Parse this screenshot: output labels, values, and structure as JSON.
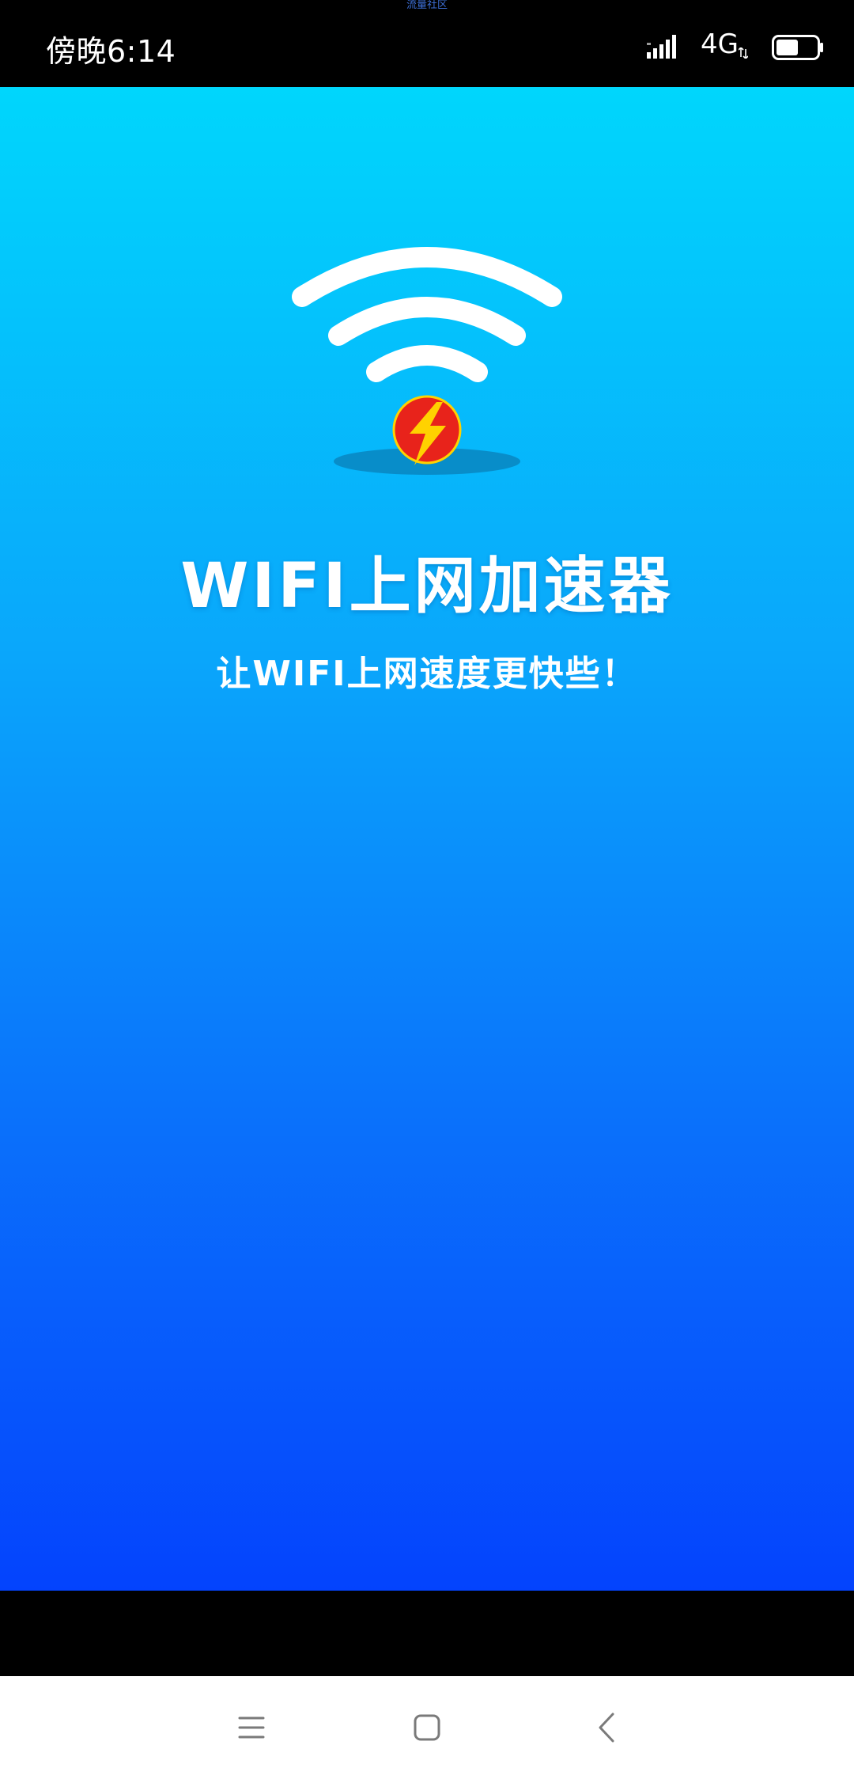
{
  "status_bar": {
    "watermark": "流量社区",
    "time": "傍晚6:14",
    "network": "4G",
    "battery_level": 0.55
  },
  "splash": {
    "title": "WIFI上网加速器",
    "slogan": "让WIFI上网速度更快些！"
  },
  "colors": {
    "gradient_top": "#00d6fc",
    "gradient_bottom": "#0443fd",
    "badge_red": "#e8231b",
    "bolt_yellow": "#ffd200"
  },
  "icons": [
    "signal-icon",
    "battery-icon",
    "wifi-icon",
    "lightning-bolt-icon",
    "menu-icon",
    "home-icon",
    "back-icon"
  ]
}
